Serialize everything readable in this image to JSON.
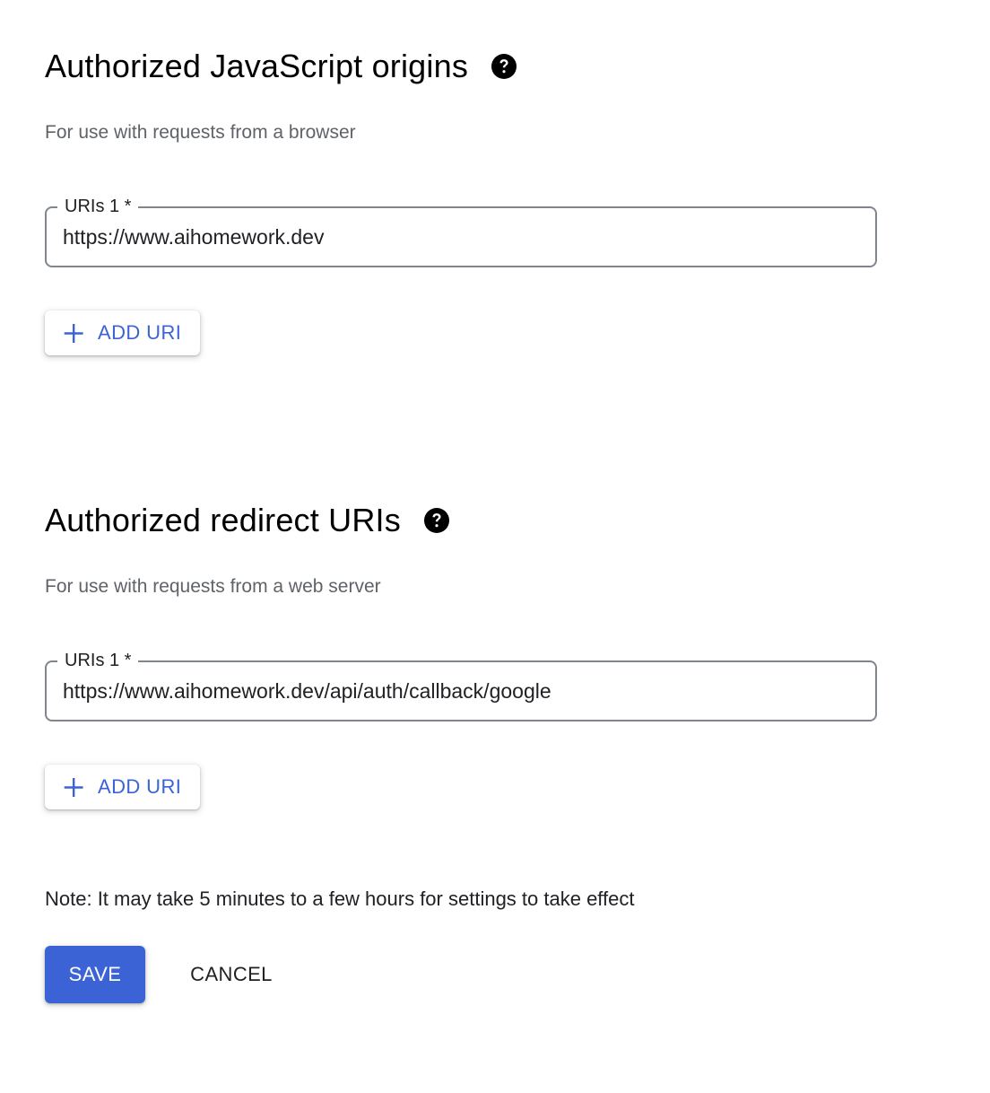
{
  "js_origins": {
    "title": "Authorized JavaScript origins",
    "help_icon": "help-circle-icon",
    "subtitle": "For use with requests from a browser",
    "uris": [
      {
        "label": "URIs 1 *",
        "value": "https://www.aihomework.dev"
      }
    ],
    "add_uri_label": "ADD URI",
    "add_icon": "plus-icon"
  },
  "redirect_uris": {
    "title": "Authorized redirect URIs",
    "help_icon": "help-circle-icon",
    "subtitle": "For use with requests from a web server",
    "uris": [
      {
        "label": "URIs 1 *",
        "value": "https://www.aihomework.dev/api/auth/callback/google"
      }
    ],
    "add_uri_label": "ADD URI",
    "add_icon": "plus-icon"
  },
  "note": "Note: It may take 5 minutes to a few hours for settings to take effect",
  "actions": {
    "save_label": "SAVE",
    "cancel_label": "CANCEL"
  },
  "colors": {
    "primary": "#3c63d6",
    "text": "#202124",
    "secondary_text": "#5f6368",
    "border": "#80868b"
  }
}
